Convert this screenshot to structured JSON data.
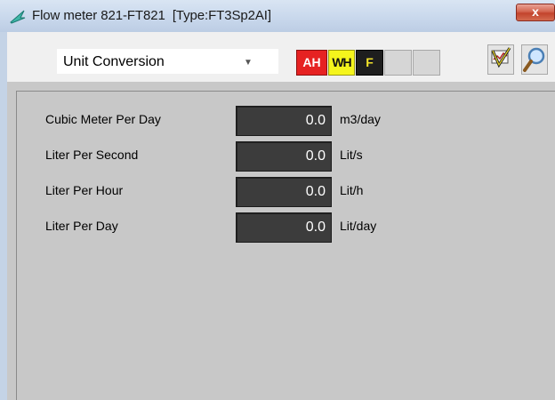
{
  "window": {
    "title": "Flow meter 821-FT821  [Type:FT3Sp2AI]",
    "close_label": "x"
  },
  "toolbar": {
    "view_select": {
      "selected": "Unit Conversion"
    },
    "alarm_indicators": [
      {
        "label": "AH",
        "color": "#e62222"
      },
      {
        "label": "WH",
        "color": "#f5f51c"
      },
      {
        "label": "F",
        "color": "#1e1e1e"
      },
      {
        "label": "",
        "color": "#d6d6d6"
      },
      {
        "label": "",
        "color": "#d6d6d6"
      }
    ],
    "icons": [
      "trend-check-icon",
      "magnifier-icon"
    ]
  },
  "rows": [
    {
      "label": "Cubic Meter Per Day",
      "value": "0.0",
      "unit": "m3/day"
    },
    {
      "label": "Liter Per Second",
      "value": "0.0",
      "unit": "Lit/s"
    },
    {
      "label": "Liter Per Hour",
      "value": "0.0",
      "unit": "Lit/h"
    },
    {
      "label": "Liter Per Day",
      "value": "0.0",
      "unit": "Lit/day"
    }
  ]
}
